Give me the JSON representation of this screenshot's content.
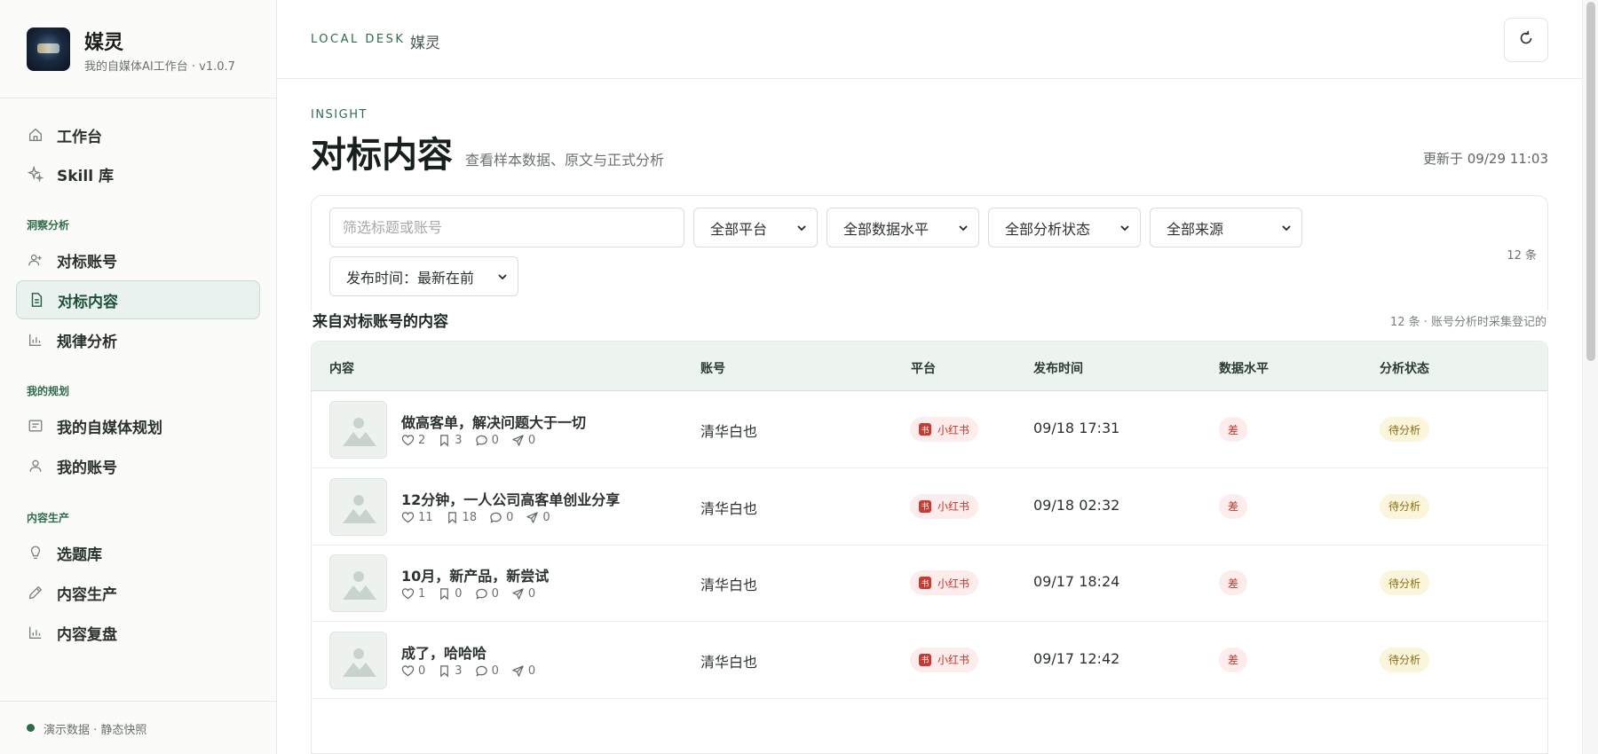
{
  "app": {
    "name": "媒灵",
    "subtitle": "我的自媒体AI工作台 · v1.0.7"
  },
  "sidebar": {
    "top_items": [
      {
        "label": "工作台",
        "icon": "home-icon"
      },
      {
        "label": "Skill 库",
        "icon": "sparkle-icon"
      }
    ],
    "sections": [
      {
        "title": "洞察分析",
        "items": [
          {
            "label": "对标账号",
            "icon": "user-add-icon"
          },
          {
            "label": "对标内容",
            "icon": "document-icon",
            "active": true
          },
          {
            "label": "规律分析",
            "icon": "bar-chart-icon"
          }
        ]
      },
      {
        "title": "我的规划",
        "items": [
          {
            "label": "我的自媒体规划",
            "icon": "plan-icon"
          },
          {
            "label": "我的账号",
            "icon": "user-icon"
          }
        ]
      },
      {
        "title": "内容生产",
        "items": [
          {
            "label": "选题库",
            "icon": "lightbulb-icon"
          },
          {
            "label": "内容生产",
            "icon": "pencil-icon"
          },
          {
            "label": "内容复盘",
            "icon": "bar-chart-icon"
          }
        ]
      }
    ],
    "footer_status": "演示数据 · 静态快照"
  },
  "topbar": {
    "eyebrow": "LOCAL DESK",
    "title": "媒灵"
  },
  "page": {
    "eyebrow": "INSIGHT",
    "title": "对标内容",
    "subtitle": "查看样本数据、原文与正式分析",
    "updated": "更新于 09/29 11:03"
  },
  "filters": {
    "search_placeholder": "筛选标题或账号",
    "platform": "全部平台",
    "data_level": "全部数据水平",
    "analysis_status": "全部分析状态",
    "source": "全部来源",
    "publish_time": "发布时间：最新在前",
    "count": "12 条"
  },
  "list": {
    "title": "来自对标账号的内容",
    "meta": "12 条 · 账号分析时采集登记的",
    "columns": [
      "内容",
      "账号",
      "平台",
      "发布时间",
      "数据水平",
      "分析状态"
    ],
    "rows": [
      {
        "title": "做高客单，解决问题大于一切",
        "likes": "2",
        "saves": "3",
        "comments": "0",
        "shares": "0",
        "account": "清华白也",
        "platform": "小红书",
        "time": "09/18 17:31",
        "level": "差",
        "status": "待分析"
      },
      {
        "title": "12分钟，一人公司高客单创业分享",
        "likes": "11",
        "saves": "18",
        "comments": "0",
        "shares": "0",
        "account": "清华白也",
        "platform": "小红书",
        "time": "09/18 02:32",
        "level": "差",
        "status": "待分析"
      },
      {
        "title": "10月，新产品，新尝试",
        "likes": "1",
        "saves": "0",
        "comments": "0",
        "shares": "0",
        "account": "清华白也",
        "platform": "小红书",
        "time": "09/17 18:24",
        "level": "差",
        "status": "待分析"
      },
      {
        "title": "成了，哈哈哈",
        "likes": "0",
        "saves": "3",
        "comments": "0",
        "shares": "0",
        "account": "清华白也",
        "platform": "小红书",
        "time": "09/17 12:42",
        "level": "差",
        "status": "待分析"
      }
    ]
  },
  "colors": {
    "accent": "#2f6b4b",
    "active_bg": "#e9f2ee",
    "table_header_bg": "#edf4f0",
    "platform_red": "#c63b32",
    "pending_bg": "#fbf5dc"
  }
}
